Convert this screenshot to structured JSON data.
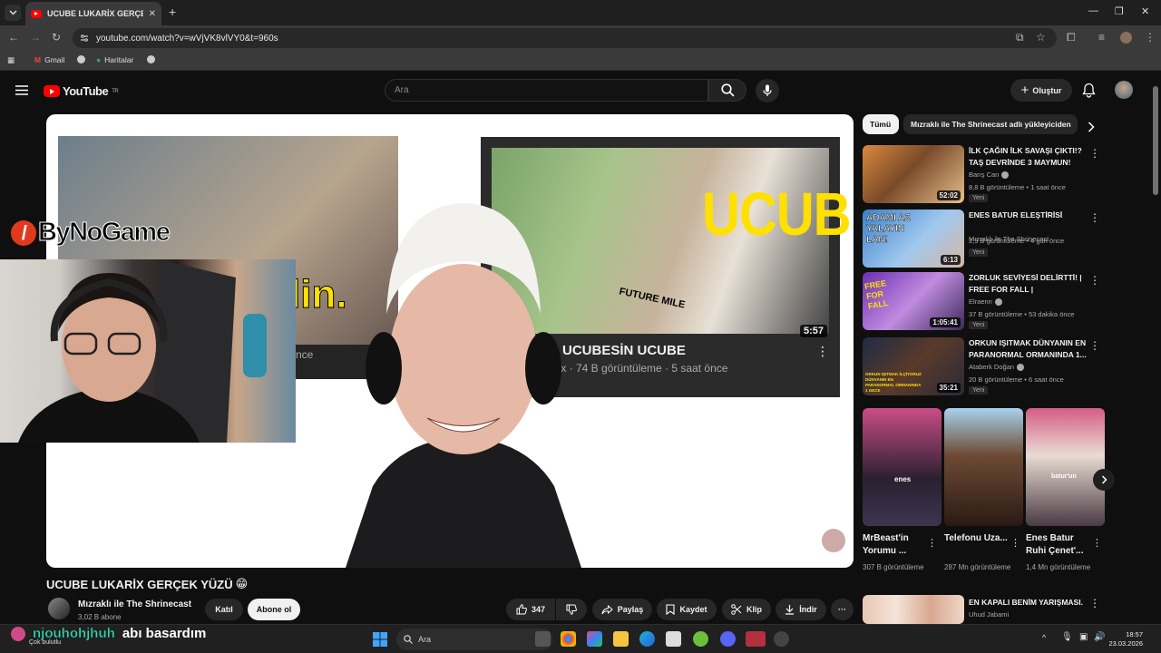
{
  "browser": {
    "tab_title": "UCUBE LUKARİX GERÇEK YÜZÜ",
    "url": "youtube.com/watch?v=wVjVK8vlVY0&t=960s",
    "bookmarks": [
      "Gmail",
      "Haritalar"
    ]
  },
  "masthead": {
    "logo_text": "YouTube",
    "logo_region": "TR",
    "search_placeholder": "Ara",
    "create_label": "Oluştur"
  },
  "player": {
    "overlay_logo": "ByNoGame",
    "thumbnail_right": {
      "title_fragment": "N UCUBESİN UCUBE",
      "meta_fragment": "arix · 74 B görüntüleme · 5 saat önce",
      "duration": "5:57",
      "big_text": "UCUBE",
      "shirt_text": "FUTURE MILE"
    },
    "thumbnail_left": {
      "text_fragment": "lin.",
      "meta_fragment": "nce"
    }
  },
  "chat": {
    "username": "njouhohjhuh",
    "message": "abı basardım"
  },
  "video": {
    "title": "UCUBE LUKARİX GERÇEK YÜZÜ",
    "title_emoji": "😁",
    "channel_name": "Mızraklı ile The Shrinecast",
    "subscribers": "3,02 B abone",
    "join_label": "Katıl",
    "subscribe_label": "Abone ol",
    "likes": "347",
    "share_label": "Paylaş",
    "save_label": "Kaydet",
    "clip_label": "Klip",
    "download_label": "İndir"
  },
  "sidebar": {
    "chips": [
      "Tümü",
      "Mızraklı ile The Shrinecast adlı yükleyiciden"
    ],
    "videos": [
      {
        "title": "İLK ÇAĞIN İLK SAVAŞI ÇIKTI!? TAŞ DEVRİNDE 3 MAYMUN!",
        "channel": "Barış Can",
        "meta": "8,8 B görüntüleme • 1 saat önce",
        "badge": "Yeni",
        "duration": "52:02",
        "verified": true
      },
      {
        "title": "ENES BATUR ELEŞTİRİSİ",
        "channel": "Mızraklı ile The Shrinecast",
        "meta": "2,9 B görüntüleme • 4 gün önce",
        "badge": "Yeni",
        "duration": "6:13",
        "verified": false
      },
      {
        "title": "ZORLUK SEVİYESİ DELİRTTİ! | FREE FOR FALL |",
        "channel": "Elraenn",
        "meta": "37 B görüntüleme • 53 dakika önce",
        "badge": "Yeni",
        "duration": "1:05:41",
        "verified": true
      },
      {
        "title": "ORKUN IŞITMAK DÜNYANIN EN PARANORMAL ORMANINDA 1...",
        "channel": "Ataberk Doğan",
        "meta": "20 B görüntüleme • 6 saat önce",
        "badge": "Yeni",
        "duration": "35:21",
        "verified": true
      }
    ],
    "thumb_texts": [
      "ADAMI AZ YALAYIN LAN!",
      "FREE FOR FALL",
      "ORKUN IŞITMAK İLÇİYORUZ DÜNYANIN EN PARANORMAL ORMANINDA 1 GECE"
    ],
    "shorts": [
      {
        "title": "MrBeast'in Yorumu ...",
        "views": "307 B görüntüleme",
        "caption": "enes"
      },
      {
        "title": "Telefonu Uza...",
        "views": "287 Mn görüntüleme",
        "caption": ""
      },
      {
        "title": "Enes Batur Ruhi Çenet'...",
        "views": "1,4 Mn görüntüleme",
        "caption": "batur'un"
      }
    ],
    "next_video": {
      "title": "EN KAPALI BENİM YARIŞMASI.",
      "channel": "Uhud Jabami"
    }
  },
  "taskbar": {
    "search_placeholder": "Ara",
    "weather": "Çok bulutlu",
    "time": "18:57",
    "date": "23.03.2026"
  },
  "colors": {
    "yt_red": "#ff0000",
    "background": "#0f0f0f",
    "chat_user": "#3ad3b0",
    "ucube_yellow": "#ffe000"
  }
}
